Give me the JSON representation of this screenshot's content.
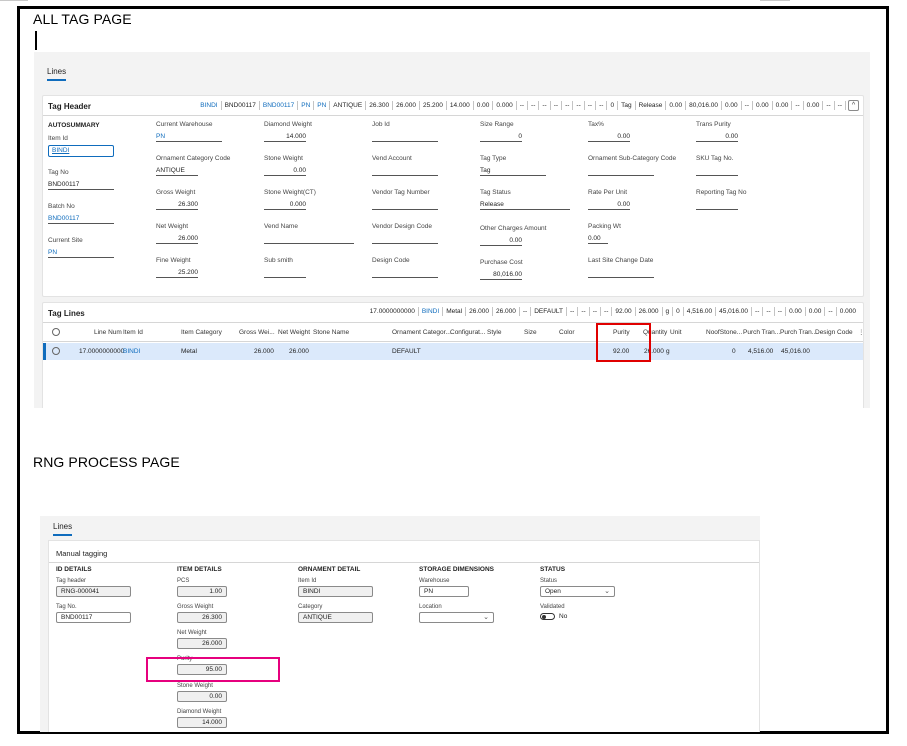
{
  "titles": {
    "tag_page": "ALL TAG PAGE",
    "rng_page": "RNG PROCESS PAGE"
  },
  "tag_page": {
    "tab": "Lines",
    "header": {
      "title": "Tag Header",
      "summary": [
        "BINDI",
        "BND00117",
        "BND00117",
        "PN",
        "PN",
        "ANTIQUE",
        "26.300",
        "26.000",
        "25.200",
        "14.000",
        "0.00",
        "0.000",
        "--",
        "--",
        "--",
        "--",
        "--",
        "--",
        "--",
        "--",
        "0",
        "Tag",
        "Release",
        "0.00",
        "80,016.00",
        "0.00",
        "--",
        "0.00",
        "0.00",
        "--",
        "0.00",
        "--",
        "--"
      ],
      "autosummary": "AUTOSUMMARY",
      "fields": {
        "item_id": {
          "label": "Item Id",
          "value": "BINDI"
        },
        "tag_no": {
          "label": "Tag No",
          "value": "BND00117"
        },
        "batch_no": {
          "label": "Batch No",
          "value": "BND00117"
        },
        "current_site": {
          "label": "Current Site",
          "value": "PN"
        },
        "current_warehouse": {
          "label": "Current Warehouse",
          "value": "PN"
        },
        "ornament_category": {
          "label": "Ornament Category Code",
          "value": "ANTIQUE"
        },
        "gross_weight": {
          "label": "Gross Weight",
          "value": "26.300"
        },
        "net_weight": {
          "label": "Net Weight",
          "value": "26.000"
        },
        "fine_weight": {
          "label": "Fine Weight",
          "value": "25.200"
        },
        "diamond_weight": {
          "label": "Diamond Weight",
          "value": "14.000"
        },
        "stone_weight": {
          "label": "Stone Weight",
          "value": "0.00"
        },
        "stone_weight_ct": {
          "label": "Stone Weight(CT)",
          "value": "0.000"
        },
        "vend_name": {
          "label": "Vend Name",
          "value": ""
        },
        "sub_smith": {
          "label": "Sub smith",
          "value": ""
        },
        "job_id": {
          "label": "Job Id",
          "value": ""
        },
        "vend_account": {
          "label": "Vend Account",
          "value": ""
        },
        "vendor_tag_number": {
          "label": "Vendor Tag Number",
          "value": ""
        },
        "vendor_design_code": {
          "label": "Vendor Design Code",
          "value": ""
        },
        "design_code": {
          "label": "Design Code",
          "value": ""
        },
        "size_range": {
          "label": "Size Range",
          "value": "0"
        },
        "tag_type": {
          "label": "Tag Type",
          "value": "Tag"
        },
        "tag_status": {
          "label": "Tag Status",
          "value": "Release"
        },
        "other_charges": {
          "label": "Other Charges Amount",
          "value": "0.00"
        },
        "purchase_cost": {
          "label": "Purchase Cost",
          "value": "80,016.00"
        },
        "tax": {
          "label": "Tax%",
          "value": "0.00"
        },
        "ornament_subcategory": {
          "label": "Ornament Sub-Category Code",
          "value": ""
        },
        "rate_per_unit": {
          "label": "Rate Per Unit",
          "value": "0.00"
        },
        "packing_wt": {
          "label": "Packing Wt",
          "value": "0.00"
        },
        "last_site_change": {
          "label": "Last Site Change Date",
          "value": ""
        },
        "trans_purity": {
          "label": "Trans Purity",
          "value": "0.00"
        },
        "sku_tag_no": {
          "label": "SKU Tag No.",
          "value": ""
        },
        "reporting_tag_no": {
          "label": "Reporting Tag No",
          "value": ""
        }
      }
    },
    "lines": {
      "title": "Tag Lines",
      "summary": [
        "17.0000000000",
        "BINDI",
        "Metal",
        "26.000",
        "26.000",
        "--",
        "DEFAULT",
        "--",
        "--",
        "--",
        "--",
        "92.00",
        "26.000",
        "g",
        "0",
        "4,516.00",
        "45,016.00",
        "--",
        "--",
        "--",
        "0.00",
        "0.00",
        "--",
        "0.000"
      ],
      "columns": {
        "line_num": "Line Num",
        "item_id": "Item Id",
        "item_category": "Item Category",
        "gross_weight": "Gross Wei...",
        "net_weight": "Net Weight",
        "stone_name": "Stone Name",
        "ornament_category": "Ornament Categor...",
        "configuration": "Configurat...",
        "style": "Style",
        "size": "Size",
        "color": "Color",
        "purity": "Purity",
        "quantity": "Quantity",
        "unit": "Unit",
        "no_of_stones": "NoofStone...",
        "purch_tran1": "Purch Tran...",
        "purch_tran2": "Purch Tran...",
        "design_code": "Design Code"
      },
      "row": {
        "line_num": "17.0000000000",
        "item_id": "BINDI",
        "item_category": "Metal",
        "gross_weight": "26.000",
        "net_weight": "26.000",
        "ornament_category": "DEFAULT",
        "purity": "92.00",
        "quantity": "26.000",
        "unit": "g",
        "no_of_stones": "0",
        "purch_tran1": "4,516.00",
        "purch_tran2": "45,016.00"
      }
    }
  },
  "rng_page": {
    "tab": "Lines",
    "title": "Manual tagging",
    "sections": {
      "id_details": "ID DETAILS",
      "item_details": "ITEM DETAILS",
      "ornament_detail": "ORNAMENT DETAIL",
      "storage_dimensions": "STORAGE DIMENSIONS",
      "status": "STATUS"
    },
    "fields": {
      "tag_header": {
        "label": "Tag header",
        "value": "RNG-000041"
      },
      "tag_no": {
        "label": "Tag No.",
        "value": "BND00117"
      },
      "pcs": {
        "label": "PCS",
        "value": "1.00"
      },
      "gross_weight": {
        "label": "Gross Weight",
        "value": "26.300"
      },
      "net_weight": {
        "label": "Net Weight",
        "value": "26.000"
      },
      "purity": {
        "label": "Purity",
        "value": "95.00"
      },
      "stone_weight": {
        "label": "Stone Weight",
        "value": "0.00"
      },
      "diamond_weight": {
        "label": "Diamond Weight",
        "value": "14.000"
      },
      "item_id": {
        "label": "Item Id",
        "value": "BINDI"
      },
      "category": {
        "label": "Category",
        "value": "ANTIQUE"
      },
      "warehouse": {
        "label": "Warehouse",
        "value": "PN"
      },
      "location": {
        "label": "Location",
        "value": ""
      },
      "status": {
        "label": "Status",
        "value": "Open"
      },
      "validated": {
        "label": "Validated",
        "value": "No"
      }
    }
  },
  "colors": {
    "accent": "#0f6cbd",
    "highlight_red": "#e00000",
    "highlight_pink": "#e6007e",
    "selected_row": "#dbe9fb"
  }
}
